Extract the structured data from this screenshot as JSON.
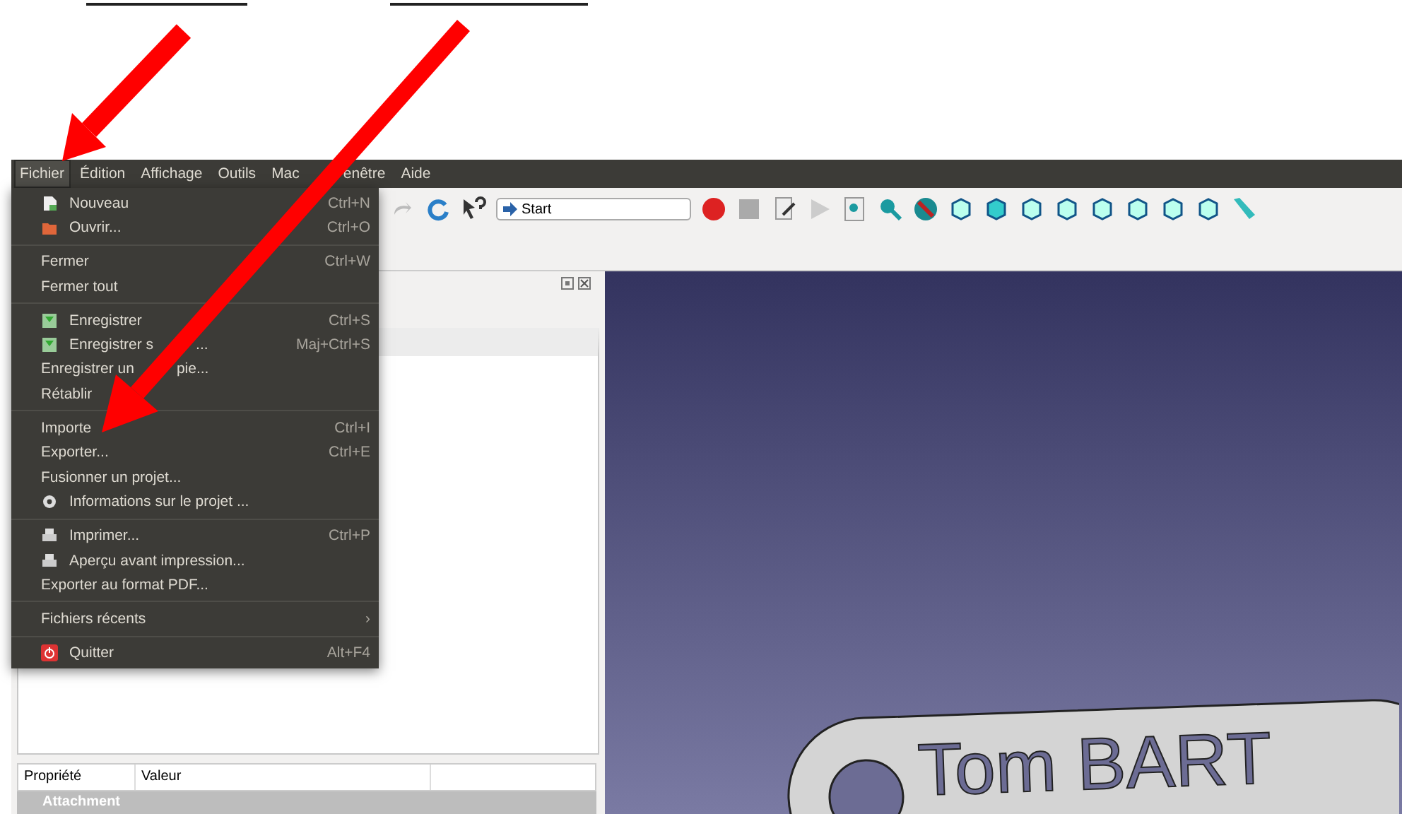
{
  "menu_bar": [
    {
      "label": "Fichier",
      "selected": true
    },
    {
      "label": "Édition",
      "selected": false
    },
    {
      "label": "Affichage",
      "selected": false
    },
    {
      "label": "Outils",
      "selected": false
    },
    {
      "label": "Mac",
      "selected": false
    },
    {
      "label": "enêtre",
      "selected": false
    },
    {
      "label": "Aide",
      "selected": false
    }
  ],
  "file_menu": [
    {
      "kind": "item",
      "label": "Nouveau",
      "shortcut": "Ctrl+N"
    },
    {
      "kind": "item",
      "label": "Ouvrir...",
      "shortcut": "Ctrl+O"
    },
    {
      "kind": "separator"
    },
    {
      "kind": "item",
      "label": "Fermer",
      "shortcut": "Ctrl+W"
    },
    {
      "kind": "item",
      "label": "Fermer tout"
    },
    {
      "kind": "separator"
    },
    {
      "kind": "item",
      "label": "Enregistrer",
      "shortcut": "Ctrl+S"
    },
    {
      "kind": "item",
      "label": "Enregistrer s",
      "label_tail": "...",
      "shortcut": "Maj+Ctrl+S"
    },
    {
      "kind": "item",
      "label": "Enregistrer un",
      "label_tail": "pie..."
    },
    {
      "kind": "item",
      "label": "Rétablir"
    },
    {
      "kind": "separator"
    },
    {
      "kind": "item",
      "label": "Importe",
      "shortcut": "Ctrl+I"
    },
    {
      "kind": "item",
      "label": "Exporter...",
      "shortcut": "Ctrl+E"
    },
    {
      "kind": "item",
      "label": "Fusionner un projet..."
    },
    {
      "kind": "item",
      "label": "Informations sur le projet ..."
    },
    {
      "kind": "separator"
    },
    {
      "kind": "item",
      "label": "Imprimer...",
      "shortcut": "Ctrl+P"
    },
    {
      "kind": "item",
      "label": "Aperçu avant impression..."
    },
    {
      "kind": "item",
      "label": "Exporter au format PDF..."
    },
    {
      "kind": "separator"
    },
    {
      "kind": "submenu",
      "label": "Fichiers récents",
      "arrow": "›"
    },
    {
      "kind": "separator"
    },
    {
      "kind": "item",
      "label": "Quitter",
      "shortcut": "Alt+F4"
    }
  ],
  "toolbar": {
    "workbench": "Start"
  },
  "property_table": {
    "columns": [
      "Propriété",
      "Valeur"
    ],
    "group": "Attachment"
  },
  "viewport": {
    "model_text": "Tom BART"
  }
}
